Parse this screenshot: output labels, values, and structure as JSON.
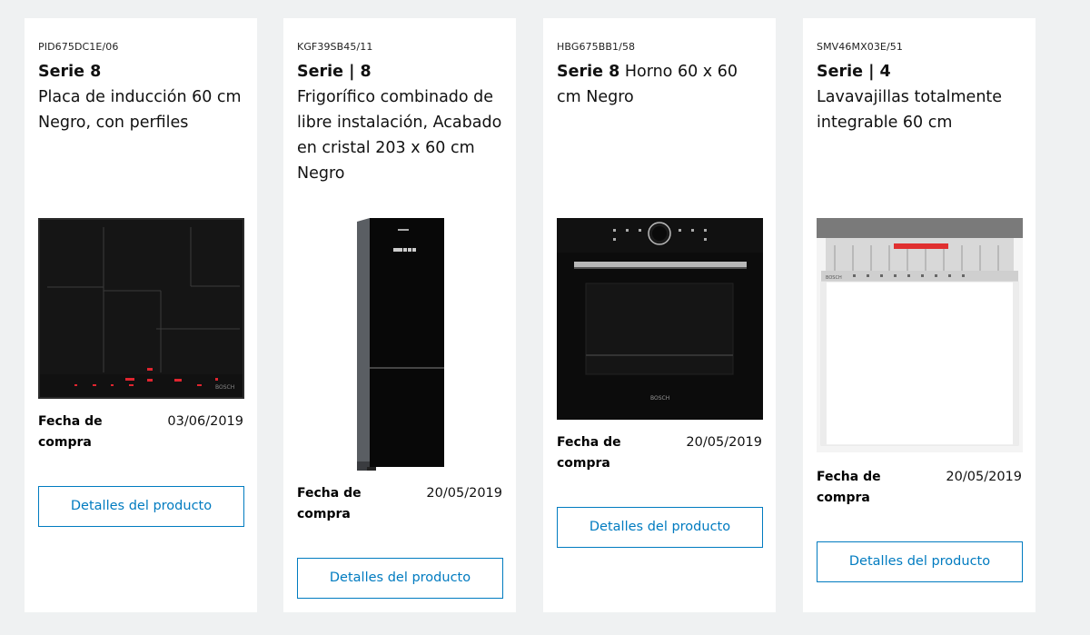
{
  "products": [
    {
      "sku": "PID675DC1E/06",
      "series": "Serie 8",
      "description": "Placa de inducción 60 cm Negro, con perfiles",
      "date_label": "Fecha de compra",
      "date": "03/06/2019",
      "button": "Detalles del producto",
      "image_icon": "induction-hob"
    },
    {
      "sku": "KGF39SB45/11",
      "series": "Serie | 8",
      "description": "Frigorífico combinado de libre instalación, Acabado en cristal 203 x 60 cm Negro",
      "date_label": "Fecha de compra",
      "date": "20/05/2019",
      "button": "Detalles del producto",
      "image_icon": "fridge-freezer"
    },
    {
      "sku": "HBG675BB1/58",
      "series": "Serie 8",
      "description": "Horno 60 x 60 cm Negro",
      "date_label": "Fecha de compra",
      "date": "20/05/2019",
      "button": "Detalles del producto",
      "image_icon": "oven"
    },
    {
      "sku": "SMV46MX03E/51",
      "series": "Serie | 4",
      "description": "Lavavajillas totalmente integrable 60 cm",
      "date_label": "Fecha de compra",
      "date": "20/05/2019",
      "button": "Detalles del producto",
      "image_icon": "dishwasher"
    }
  ],
  "colors": {
    "page_bg": "#eff1f2",
    "card_bg": "#ffffff",
    "accent": "#007bc0"
  }
}
